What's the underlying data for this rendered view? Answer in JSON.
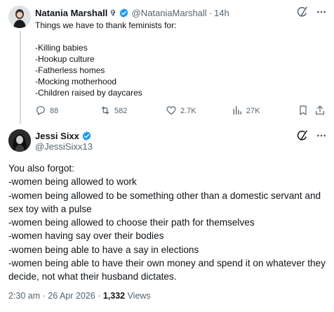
{
  "colors": {
    "verified_blue": "#1d9bf0",
    "text_primary": "#0f1419",
    "text_secondary": "#536471",
    "thread_line": "#cfd9de"
  },
  "parent_tweet": {
    "author_name": "Natania Marshall",
    "author_extra": "✞",
    "handle": "@NataniaMarshall",
    "separator": "·",
    "time": "14h",
    "text": "Things we have to thank feminists for:\n\n-Killing babies\n-Hookup culture\n-Fatherless homes\n-Mocking motherhood\n-Children raised by daycares",
    "actions": {
      "replies": "88",
      "reposts": "582",
      "likes": "2.7K",
      "views": "27K"
    },
    "icons": [
      "grok-icon",
      "more-icon",
      "reply-icon",
      "repost-icon",
      "like-icon",
      "views-icon",
      "bookmark-icon",
      "share-icon"
    ]
  },
  "reply_tweet": {
    "author_name": "Jessi Sixx",
    "handle": "@JessiSixx13",
    "text": "You also forgot:\n-women being allowed to work\n-women being allowed to be something other than a domestic servant and sex toy with a pulse\n-women being allowed to choose their path for themselves\n-women having say over their bodies\n-women being able to have a say in elections\n-women being able to have their own money and spend it on whatever they decide, not what their husband dictates.",
    "timestamp": "2:30 am · 26 Apr 2026 · ",
    "views_count": "1,332",
    "views_label": " Views"
  }
}
